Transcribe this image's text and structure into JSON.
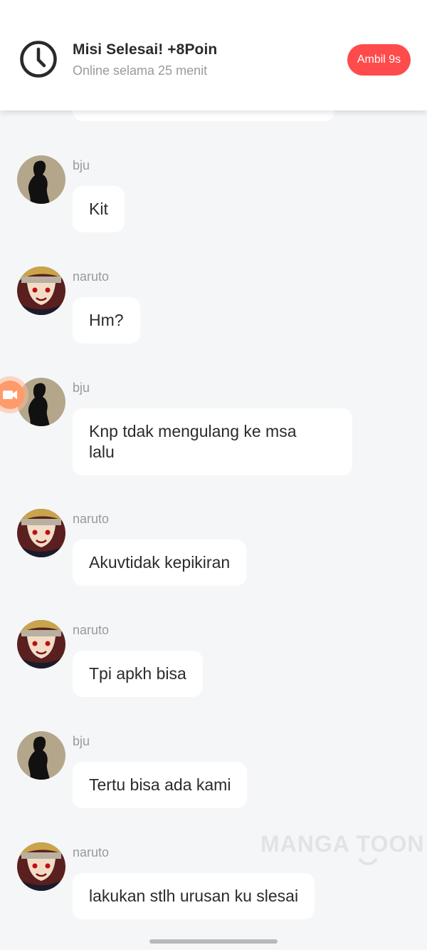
{
  "banner": {
    "title": "Misi Selesai! +8Poin",
    "subtitle": "Online selama 25 menit",
    "cta_label": "Ambil 9s",
    "icon": "clock-icon",
    "cta_color": "#ff4b4b"
  },
  "messages": [
    {
      "sender": "bju",
      "avatar": "silhouette-avatar",
      "text": "Kit"
    },
    {
      "sender": "naruto",
      "avatar": "anime-avatar",
      "text": "Hm?"
    },
    {
      "sender": "bju",
      "avatar": "silhouette-avatar",
      "text_line1": "Knp tdak mengulang ke msa",
      "text_line2": "lalu"
    },
    {
      "sender": "naruto",
      "avatar": "anime-avatar",
      "text": "Akuvtidak kepikiran"
    },
    {
      "sender": "naruto",
      "avatar": "anime-avatar",
      "text": "Tpi apkh bisa"
    },
    {
      "sender": "bju",
      "avatar": "silhouette-avatar",
      "text": "Tertu bisa ada kami"
    },
    {
      "sender": "naruto",
      "avatar": "anime-avatar",
      "text": "lakukan stlh urusan ku slesai"
    }
  ],
  "watermark": "MANGA TOON",
  "floating_button_icon": "video-camera-icon",
  "colors": {
    "background": "#f5f6f8",
    "bubble": "#ffffff",
    "accent": "#ff4b4b"
  }
}
